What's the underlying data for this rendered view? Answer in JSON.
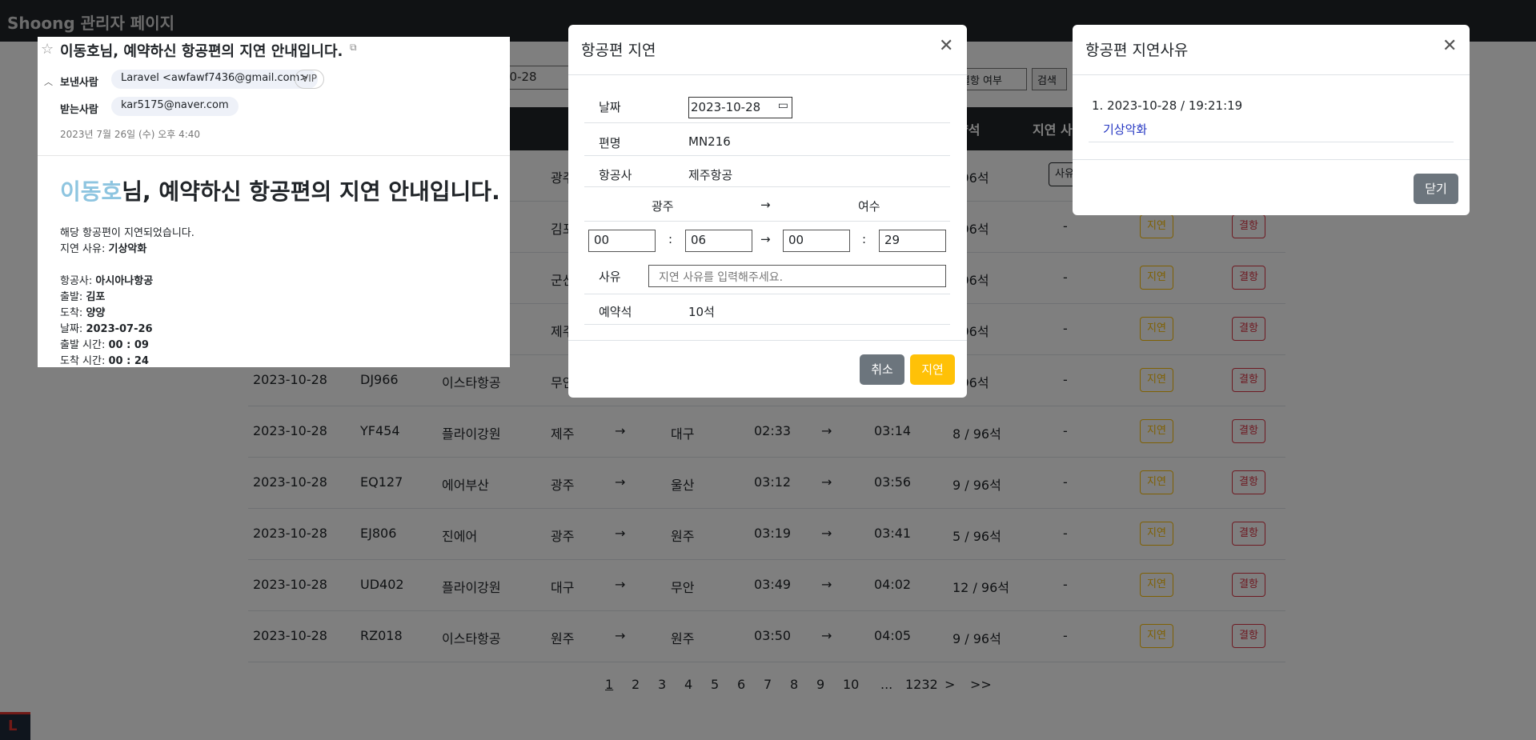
{
  "brand": "Shoong 관리자 페이지",
  "filters": {
    "date_partial": "10-28",
    "select_label": "결항 여부",
    "search_label": "검색"
  },
  "table": {
    "headers": {
      "seats": "약석",
      "delay_reason": "지연 사"
    },
    "visible_partial": [
      {
        "from": "광주",
        "seat": "/ 96석",
        "reason_btn": "사유"
      },
      {
        "from": "김포",
        "seat": "/ 96석"
      },
      {
        "from": "군산",
        "seat": "/ 96석"
      },
      {
        "from": "제주",
        "seat": "/ 96석"
      }
    ],
    "rows": [
      {
        "date": "2023-10-28",
        "code": "DJ966",
        "airline": "이스타항공",
        "from": "무안",
        "to": "",
        "dep": "",
        "arr": "",
        "seat": "/ 96석",
        "reason": "-"
      },
      {
        "date": "2023-10-28",
        "code": "YF454",
        "airline": "플라이강원",
        "from": "제주",
        "to": "대구",
        "dep": "02:33",
        "arr": "03:14",
        "seat": "8 / 96석",
        "reason": "-"
      },
      {
        "date": "2023-10-28",
        "code": "EQ127",
        "airline": "에어부산",
        "from": "광주",
        "to": "울산",
        "dep": "03:12",
        "arr": "03:56",
        "seat": "9 / 96석",
        "reason": "-"
      },
      {
        "date": "2023-10-28",
        "code": "EJ806",
        "airline": "진에어",
        "from": "광주",
        "to": "원주",
        "dep": "03:19",
        "arr": "03:41",
        "seat": "5 / 96석",
        "reason": "-"
      },
      {
        "date": "2023-10-28",
        "code": "UD402",
        "airline": "플라이강원",
        "from": "대구",
        "to": "무안",
        "dep": "03:49",
        "arr": "04:02",
        "seat": "12 / 96석",
        "reason": "-"
      },
      {
        "date": "2023-10-28",
        "code": "RZ018",
        "airline": "이스타항공",
        "from": "원주",
        "to": "원주",
        "dep": "03:50",
        "arr": "04:05",
        "seat": "9 / 96석",
        "reason": "-"
      }
    ],
    "arrow": "→",
    "delay_btn": "지연",
    "cancel_btn": "결항"
  },
  "pagination": [
    "1",
    "2",
    "3",
    "4",
    "5",
    "6",
    "7",
    "8",
    "9",
    "10",
    "...",
    "1232",
    ">",
    ">>"
  ],
  "email": {
    "subject": "이동호님, 예약하신 항공편의 지연 안내입니다.",
    "from_label": "보낸사람",
    "from_value": "Laravel <awfawf7436@gmail.com>",
    "vip": "VIP",
    "to_label": "받는사람",
    "to_value": "kar5175@naver.com",
    "date": "2023년 7월 26일 (수) 오후 4:40",
    "heading_name": "이동호",
    "heading_rest": "님, 예약하신 항공편의 지연 안내입니다.",
    "line1": "해당 항공편이 지연되었습니다.",
    "reason_label": "지연 사유: ",
    "reason_value": "기상악화",
    "airline_label": "항공사: ",
    "airline_value": "아시아나항공",
    "dep_label": "출발: ",
    "dep_value": "김포",
    "arr_label": "도착: ",
    "arr_value": "양양",
    "date_label": "날짜: ",
    "date_value": "2023-07-26",
    "dep_time_label": "출발 시간: ",
    "dep_time_value": "00 : 09",
    "arr_time_label": "도착 시간: ",
    "arr_time_value": "00 : 24"
  },
  "delay_modal": {
    "title": "항공편 지연",
    "date_label": "날짜",
    "date_value": "2023-10-28",
    "flight_label": "편명",
    "flight_value": "MN216",
    "airline_label": "항공사",
    "airline_value": "제주항공",
    "from": "광주",
    "arrow": "→",
    "to": "여수",
    "dep_hour": "00",
    "dep_min": "06",
    "arr_hour": "00",
    "arr_min": "29",
    "colon": ":",
    "reason_label": "사유",
    "reason_placeholder": "지연 사유를 입력해주세요.",
    "seat_label": "예약석",
    "seat_value": "10석",
    "cancel": "취소",
    "confirm": "지연"
  },
  "reason_modal": {
    "title": "항공편 지연사유",
    "entry_date": "1. 2023-10-28 / 19:21:19",
    "entry_reason": "기상악화",
    "close": "닫기"
  },
  "colors": {
    "dark": "#212529",
    "warning": "#ffc107",
    "danger": "#dc3545",
    "secondary": "#6c757d"
  }
}
